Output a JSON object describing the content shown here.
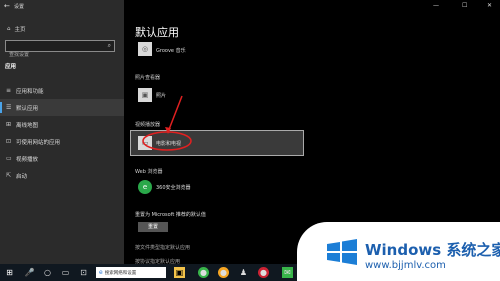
{
  "window": {
    "title": "设置",
    "back": "←",
    "minimize": "—",
    "maximize": "☐",
    "close": "✕"
  },
  "sidebar": {
    "home": "主页",
    "search_placeholder": "查找设置",
    "section": "应用",
    "items": [
      {
        "label": "应用和功能",
        "icon": "≡"
      },
      {
        "label": "默认应用",
        "icon": "☰"
      },
      {
        "label": "离线地图",
        "icon": "⊞"
      },
      {
        "label": "可使用网站的应用",
        "icon": "⊡"
      },
      {
        "label": "视频播放",
        "icon": "▭"
      },
      {
        "label": "启动",
        "icon": "⇱"
      }
    ]
  },
  "main": {
    "title": "默认应用",
    "music_app": "Groove 音乐",
    "photo_category": "照片查看器",
    "photo_app": "照片",
    "video_category": "视频播放器",
    "video_app": "电影和电视",
    "web_category": "Web 浏览器",
    "web_app": "360安全浏览器",
    "reset_text": "重置为 Microsoft 推荐的默认值",
    "reset_button": "重置",
    "link1": "按文件类型指定默认应用",
    "link2": "按协议指定默认应用"
  },
  "taskbar": {
    "search_placeholder": "搜索网络和设置"
  },
  "watermark": {
    "text": "Windows 系统之家",
    "url": "www.bjjmlv.com"
  },
  "colors": {
    "accent": "#4aa3e8",
    "annotation": "#e02020",
    "brand": "#1c5fae"
  }
}
